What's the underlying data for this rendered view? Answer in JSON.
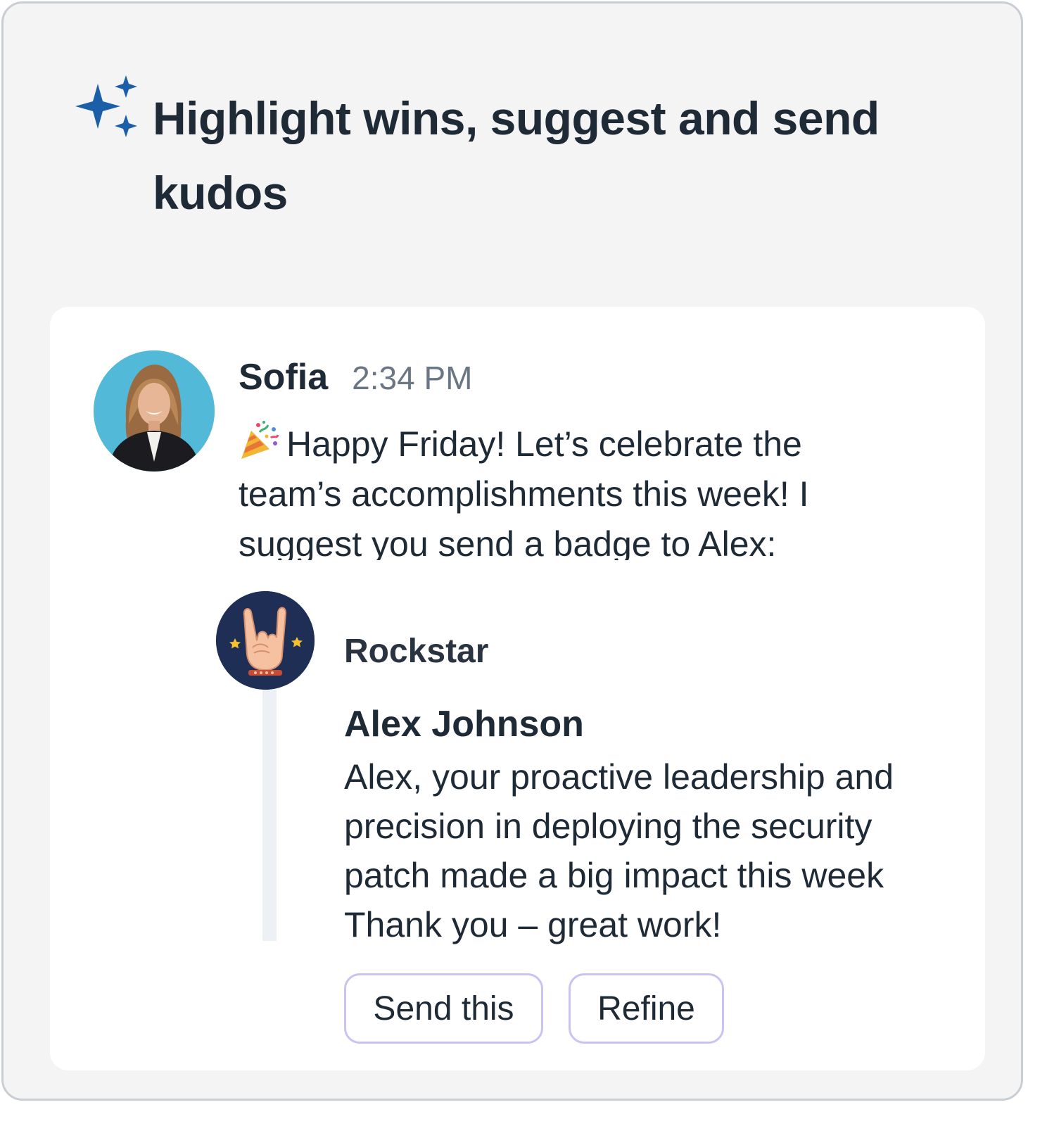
{
  "header": {
    "title": "Highlight wins, suggest and send kudos",
    "icon": "sparkle-icon",
    "icon_color": "#1a5fa8"
  },
  "message": {
    "sender": "Sofia",
    "time": "2:34 PM",
    "emoji": "party-popper-icon",
    "text": "Happy Friday!  Let’s celebrate the team’s accomplishments this week! I suggest you send a badge to Alex:"
  },
  "badge": {
    "icon": "rock-hand-icon",
    "name": "Rockstar",
    "recipient": "Alex Johnson",
    "message": "Alex, your proactive leadership and precision in deploying the security patch made a big impact this week Thank you – great work!"
  },
  "actions": {
    "send_label": "Send this",
    "refine_label": "Refine"
  },
  "colors": {
    "background": "#f4f4f4",
    "card": "#ffffff",
    "button_border": "#c9c3f3",
    "badge_bg": "#1e2e55",
    "avatar_bg": "#52b9d8"
  }
}
